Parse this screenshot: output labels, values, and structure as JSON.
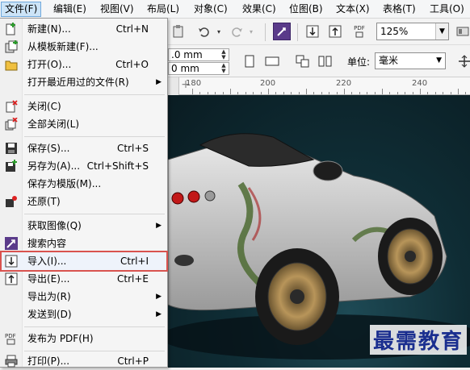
{
  "menubar": {
    "items": [
      {
        "label": "文件(F)",
        "active": true
      },
      {
        "label": "编辑(E)"
      },
      {
        "label": "视图(V)"
      },
      {
        "label": "布局(L)"
      },
      {
        "label": "对象(C)"
      },
      {
        "label": "效果(C)"
      },
      {
        "label": "位图(B)"
      },
      {
        "label": "文本(X)"
      },
      {
        "label": "表格(T)"
      },
      {
        "label": "工具(O)"
      }
    ]
  },
  "toolbar": {
    "zoom": "125%",
    "width_value": ".0 mm",
    "height_value": "0 mm",
    "unit_label": "单位:",
    "unit_value": "毫米",
    "pdf_label": "PDF"
  },
  "ruler": {
    "labels": [
      "180",
      "200",
      "220",
      "240"
    ]
  },
  "file_menu": {
    "items": [
      {
        "label": "新建(N)...",
        "shortcut": "Ctrl+N",
        "icon": "new-doc-icon"
      },
      {
        "label": "从模板新建(F)...",
        "shortcut": "",
        "icon": "template-icon"
      },
      {
        "label": "打开(O)...",
        "shortcut": "Ctrl+O",
        "icon": "open-folder-icon"
      },
      {
        "label": "打开最近用过的文件(R)",
        "shortcut": "",
        "submenu": true
      },
      {
        "label": "关闭(C)",
        "shortcut": "",
        "icon": "close-doc-icon"
      },
      {
        "label": "全部关闭(L)",
        "shortcut": "",
        "icon": "close-all-icon"
      },
      {
        "label": "保存(S)...",
        "shortcut": "Ctrl+S",
        "icon": "save-icon"
      },
      {
        "label": "另存为(A)...",
        "shortcut": "Ctrl+Shift+S",
        "icon": "save-as-icon"
      },
      {
        "label": "保存为模版(M)...",
        "shortcut": ""
      },
      {
        "label": "还原(T)",
        "shortcut": "",
        "icon": "revert-icon"
      },
      {
        "label": "获取图像(Q)",
        "shortcut": "",
        "submenu": true
      },
      {
        "label": "搜索内容",
        "shortcut": "",
        "icon": "search-content-icon"
      },
      {
        "label": "导入(I)...",
        "shortcut": "Ctrl+I",
        "icon": "import-icon",
        "highlighted": true
      },
      {
        "label": "导出(E)...",
        "shortcut": "Ctrl+E",
        "icon": "export-icon"
      },
      {
        "label": "导出为(R)",
        "shortcut": "",
        "submenu": true
      },
      {
        "label": "发送到(D)",
        "shortcut": "",
        "submenu": true
      },
      {
        "label": "发布为 PDF(H)",
        "shortcut": "",
        "icon": "pdf-icon"
      },
      {
        "label": "打印(P)...",
        "shortcut": "Ctrl+P",
        "icon": "print-icon"
      }
    ]
  },
  "watermark": "最需教育",
  "colors": {
    "highlight_border": "#d9534f",
    "menu_active_bg": "#cce4f7",
    "canvas_bg": "#0f2d35"
  }
}
